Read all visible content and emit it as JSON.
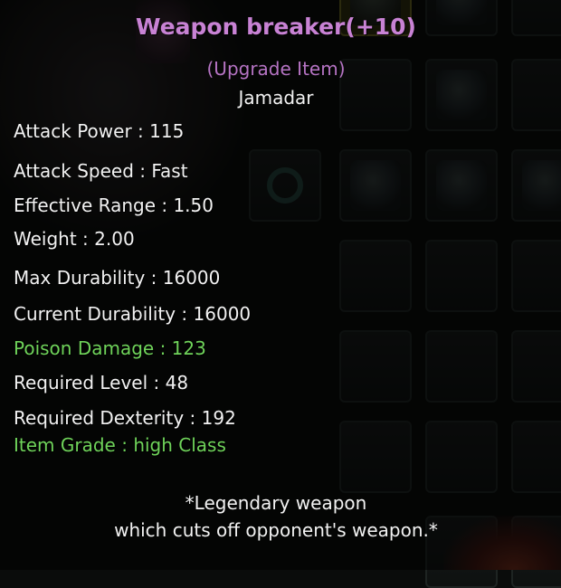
{
  "tooltip": {
    "title": "Weapon breaker(+10)",
    "subtitle": "(Upgrade Item)",
    "item_type": "Jamadar",
    "stats": [
      {
        "text": "Attack Power : 115",
        "color": "#f2f2f2"
      },
      {
        "text": "Attack Speed : Fast",
        "color": "#f2f2f2"
      },
      {
        "text": "Effective Range : 1.50",
        "color": "#f2f2f2"
      },
      {
        "text": "Weight : 2.00",
        "color": "#f2f2f2"
      },
      {
        "text": "Max Durability : 16000",
        "color": "#f2f2f2"
      },
      {
        "text": "Current Durability : 16000",
        "color": "#f2f2f2"
      },
      {
        "text": "Poison Damage : 123",
        "color": "#6fd35a"
      },
      {
        "text": "Required Level : 48",
        "color": "#f2f2f2"
      },
      {
        "text": "Required Dexterity : 192",
        "color": "#f2f2f2"
      },
      {
        "text": "Item Grade : high Class",
        "color": "#6fd35a"
      }
    ],
    "description": [
      "*Legendary weapon",
      "which cuts off opponent's weapon.*"
    ]
  },
  "colors": {
    "title": "#c882d4",
    "subtitle": "#b674c4",
    "text": "#f2f2f2",
    "highlight": "#6fd35a"
  }
}
